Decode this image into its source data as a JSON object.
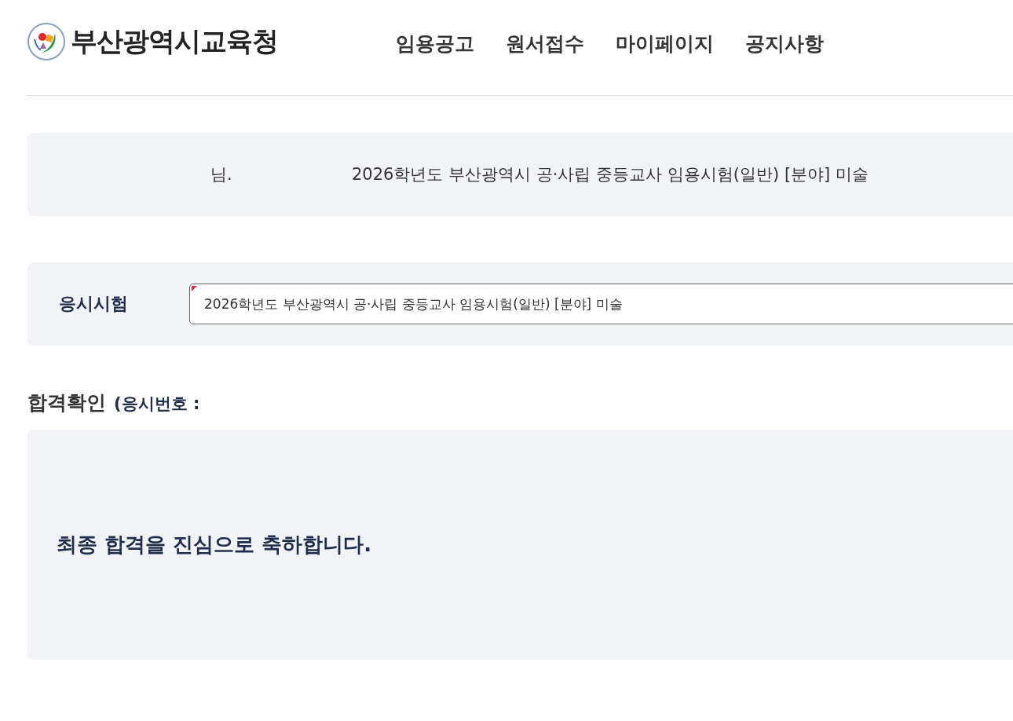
{
  "header": {
    "logo_text": "부산광역시교육청",
    "nav": [
      {
        "label": "임용공고"
      },
      {
        "label": "원서접수"
      },
      {
        "label": "마이페이지"
      },
      {
        "label": "공지사항"
      }
    ]
  },
  "info_banner": {
    "greeting": "님.",
    "exam_title": "2026학년도 부산광역시 공·사립 중등교사 임용시험(일반) [분야] 미술"
  },
  "exam_select": {
    "label": "응시시험",
    "value": "2026학년도 부산광역시 공·사립 중등교사 임용시험(일반) [분야] 미술"
  },
  "result": {
    "heading": "합격확인",
    "subheading": "(응시번호 :",
    "message": "최종 합격을 진심으로 축하합니다."
  }
}
